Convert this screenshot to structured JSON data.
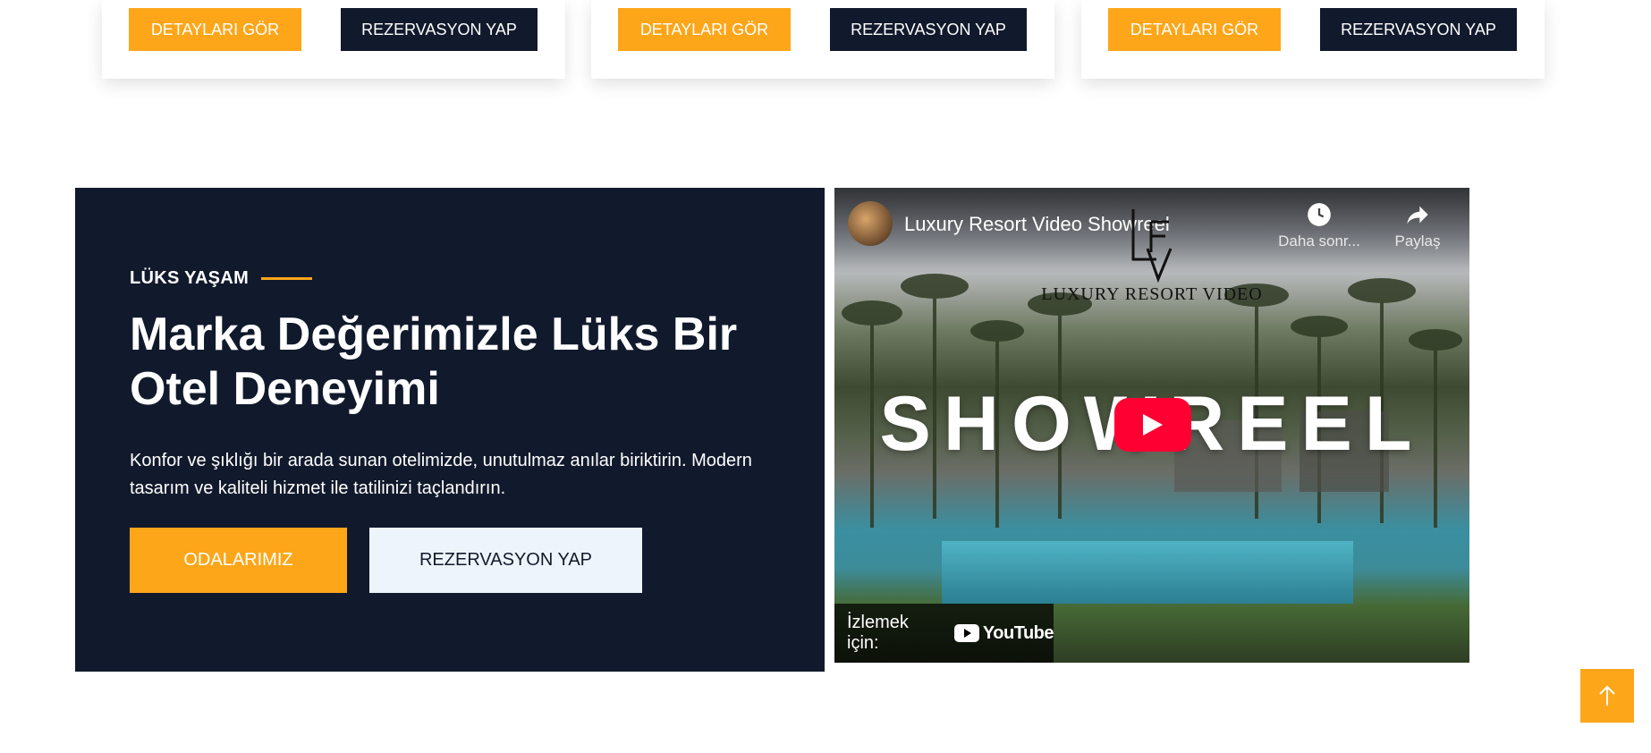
{
  "cards": [
    {
      "details_label": "DETAYLARI GÖR",
      "book_label": "REZERVASYON YAP"
    },
    {
      "details_label": "DETAYLARI GÖR",
      "book_label": "REZERVASYON YAP"
    },
    {
      "details_label": "DETAYLARI GÖR",
      "book_label": "REZERVASYON YAP"
    }
  ],
  "promo": {
    "eyebrow": "LÜKS YAŞAM",
    "headline": "Marka Değerimizle Lüks Bir Otel Deneyimi",
    "description": "Konfor ve şıklığı bir arada sunan otelimizde, unutulmaz anılar biriktirin. Modern tasarım ve kaliteli hizmet ile tatilinizi taçlandırın.",
    "rooms_button": "ODALARIMIZ",
    "book_button": "REZERVASYON YAP"
  },
  "video": {
    "title": "Luxury Resort Video Showreel",
    "watch_later": "Daha sonr...",
    "share": "Paylaş",
    "logo_text": "LUXURY RESORT VIDEO",
    "overlay_word": "SHOWREEL",
    "watch_on": "İzlemek için:",
    "youtube_word": "YouTube"
  },
  "colors": {
    "accent": "#fda61a",
    "navy": "#111a2c",
    "light_button": "#eef4fc",
    "youtube_red": "#ff0033"
  },
  "icons": {
    "play": "play-icon",
    "clock": "clock-icon",
    "share": "share-icon",
    "back_to_top": "arrow-up-icon"
  }
}
